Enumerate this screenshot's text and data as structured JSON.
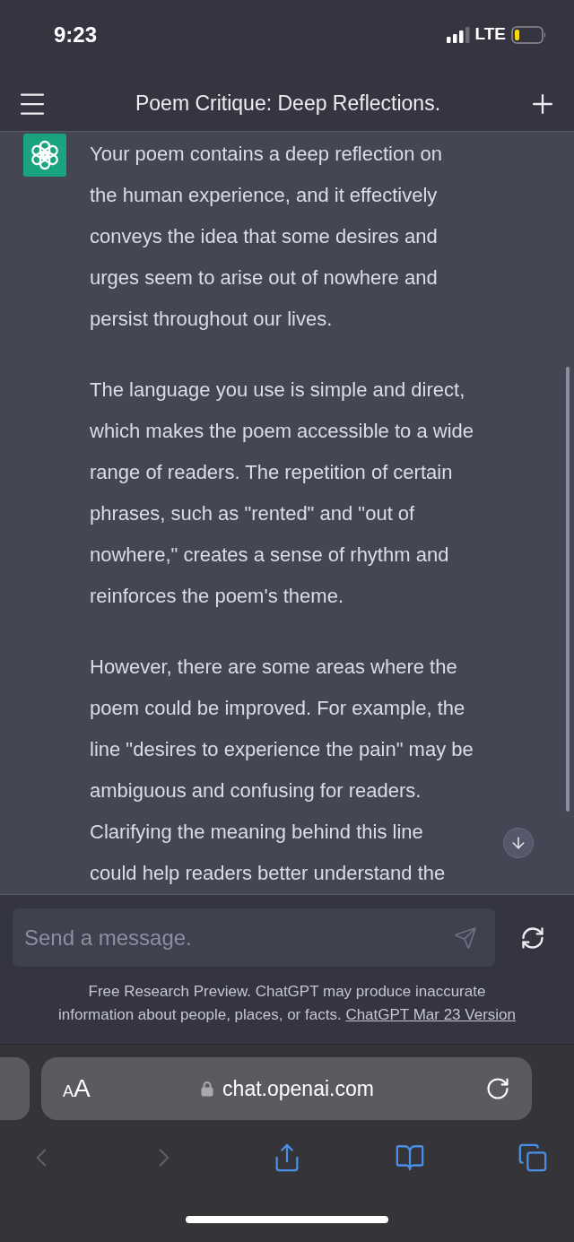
{
  "status_bar": {
    "time": "9:23",
    "network": "LTE"
  },
  "header": {
    "title": "Poem Critique: Deep Reflections."
  },
  "messages": [
    {
      "paragraphs": [
        {
          "lines": [
            "Your poem contains a deep reflection on",
            "the human experience, and it effectively",
            "conveys the idea that some desires and",
            "urges seem to arise out of nowhere and",
            "persist throughout our lives."
          ]
        },
        {
          "lines": [
            "The language you use is simple and direct,",
            "which makes the poem accessible to a wide",
            "range of readers. The repetition of certain",
            "phrases, such as \"rented\" and \"out of",
            "nowhere,\" creates a sense of rhythm and",
            "reinforces the poem's theme."
          ]
        },
        {
          "lines": [
            "However, there are some areas where the",
            "poem could be improved. For example, the",
            "line \"desires to experience the pain\" may be",
            "ambiguous and confusing for readers.",
            "Clarifying the meaning behind this line",
            "could help readers better understand the"
          ]
        }
      ]
    }
  ],
  "composer": {
    "placeholder": "Send a message."
  },
  "disclaimer": {
    "text": "Free Research Preview. ChatGPT may produce inaccurate information about people, places, or facts.",
    "link": "ChatGPT Mar 23 Version"
  },
  "browser": {
    "text_size_label": "AA",
    "url": "chat.openai.com",
    "toolbar": [
      {
        "kind": "back",
        "disabled": true
      },
      {
        "kind": "forward",
        "disabled": true
      },
      {
        "kind": "share",
        "disabled": false
      },
      {
        "kind": "bookmarks",
        "disabled": false
      },
      {
        "kind": "tabs",
        "disabled": false
      }
    ]
  }
}
